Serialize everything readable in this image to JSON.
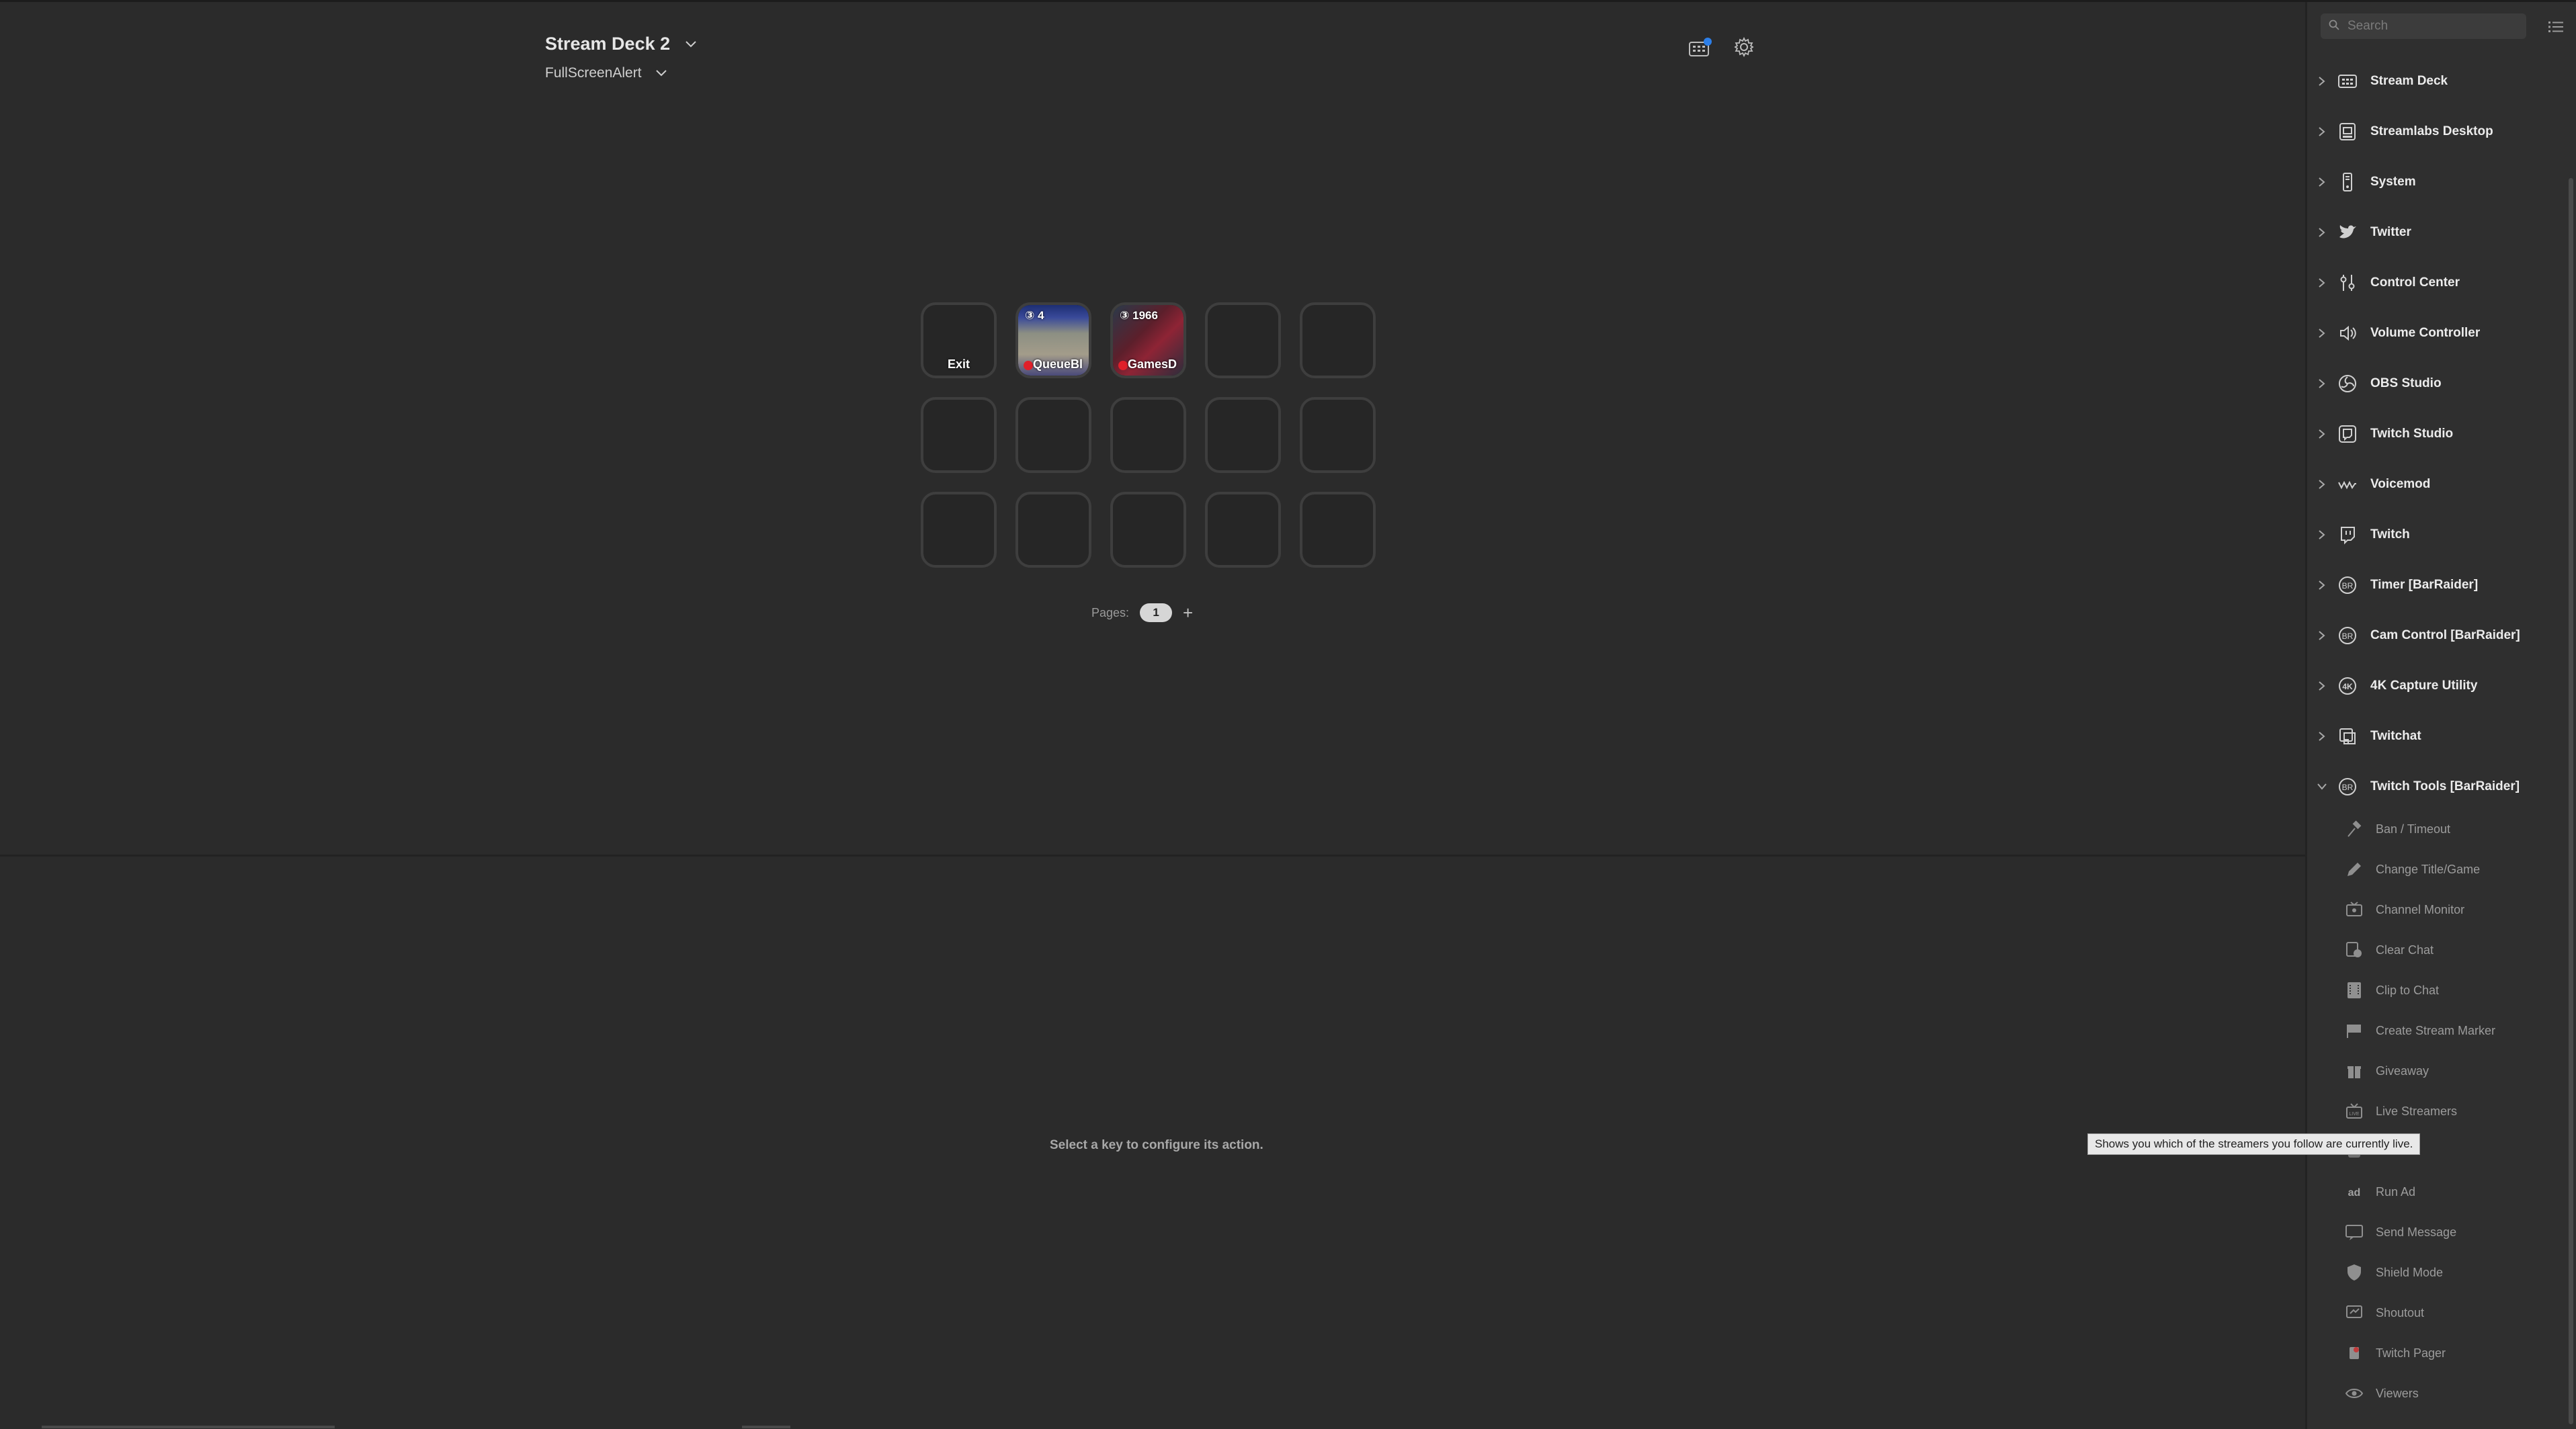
{
  "header": {
    "device_name": "Stream Deck 2",
    "profile_name": "FullScreenAlert",
    "store_icon": "store-icon",
    "settings_icon": "gear-icon"
  },
  "keys": [
    {
      "label": "Exit",
      "top": "",
      "thumb": "none"
    },
    {
      "label": "QueueBl",
      "top": "③ 4",
      "thumb": "queue"
    },
    {
      "label": "GamesD",
      "top": "③ 1966",
      "thumb": "games"
    },
    {
      "label": "",
      "top": "",
      "thumb": "none"
    },
    {
      "label": "",
      "top": "",
      "thumb": "none"
    },
    {
      "label": "",
      "top": "",
      "thumb": "none"
    },
    {
      "label": "",
      "top": "",
      "thumb": "none"
    },
    {
      "label": "",
      "top": "",
      "thumb": "none"
    },
    {
      "label": "",
      "top": "",
      "thumb": "none"
    },
    {
      "label": "",
      "top": "",
      "thumb": "none"
    },
    {
      "label": "",
      "top": "",
      "thumb": "none"
    },
    {
      "label": "",
      "top": "",
      "thumb": "none"
    },
    {
      "label": "",
      "top": "",
      "thumb": "none"
    },
    {
      "label": "",
      "top": "",
      "thumb": "none"
    },
    {
      "label": "",
      "top": "",
      "thumb": "none"
    }
  ],
  "pages": {
    "label": "Pages:",
    "current": "1",
    "add": "+"
  },
  "hint": "Select a key to configure its action.",
  "search": {
    "placeholder": "Search"
  },
  "categories": [
    {
      "label": "Stream Deck",
      "icon": "streamdeck-icon",
      "expanded": false
    },
    {
      "label": "Streamlabs Desktop",
      "icon": "streamlabs-icon",
      "expanded": false
    },
    {
      "label": "System",
      "icon": "system-icon",
      "expanded": false
    },
    {
      "label": "Twitter",
      "icon": "twitter-icon",
      "expanded": false
    },
    {
      "label": "Control Center",
      "icon": "control-center-icon",
      "expanded": false
    },
    {
      "label": "Volume Controller",
      "icon": "volume-icon",
      "expanded": false
    },
    {
      "label": "OBS Studio",
      "icon": "obs-icon",
      "expanded": false
    },
    {
      "label": "Twitch Studio",
      "icon": "twitch-studio-icon",
      "expanded": false
    },
    {
      "label": "Voicemod",
      "icon": "voicemod-icon",
      "expanded": false
    },
    {
      "label": "Twitch",
      "icon": "twitch-icon",
      "expanded": false
    },
    {
      "label": "Timer [BarRaider]",
      "icon": "barraider-icon",
      "expanded": false
    },
    {
      "label": "Cam Control [BarRaider]",
      "icon": "barraider-icon",
      "expanded": false
    },
    {
      "label": "4K Capture Utility",
      "icon": "4k-icon",
      "expanded": false
    },
    {
      "label": "Twitchat",
      "icon": "twitchat-icon",
      "expanded": false
    },
    {
      "label": "Twitch Tools [BarRaider]",
      "icon": "barraider-icon",
      "expanded": true
    }
  ],
  "actions": [
    {
      "label": "Ban / Timeout",
      "icon": "ban-hammer-icon"
    },
    {
      "label": "Change Title/Game",
      "icon": "pencil-icon"
    },
    {
      "label": "Channel Monitor",
      "icon": "monitor-icon"
    },
    {
      "label": "Clear Chat",
      "icon": "clear-chat-icon"
    },
    {
      "label": "Clip to Chat",
      "icon": "clip-icon"
    },
    {
      "label": "Create Stream Marker",
      "icon": "marker-flag-icon"
    },
    {
      "label": "Giveaway",
      "icon": "gift-icon"
    },
    {
      "label": "Live Streamers",
      "icon": "live-tv-icon"
    },
    {
      "label": "",
      "icon": "obscured-icon"
    },
    {
      "label": "Run Ad",
      "icon": "ad-icon"
    },
    {
      "label": "Send Message",
      "icon": "message-icon"
    },
    {
      "label": "Shield Mode",
      "icon": "shield-icon"
    },
    {
      "label": "Shoutout",
      "icon": "shoutout-icon"
    },
    {
      "label": "Twitch Pager",
      "icon": "pager-icon"
    },
    {
      "label": "Viewers",
      "icon": "eye-icon"
    }
  ],
  "tooltip": "Shows you which of the streamers you follow are currently live."
}
